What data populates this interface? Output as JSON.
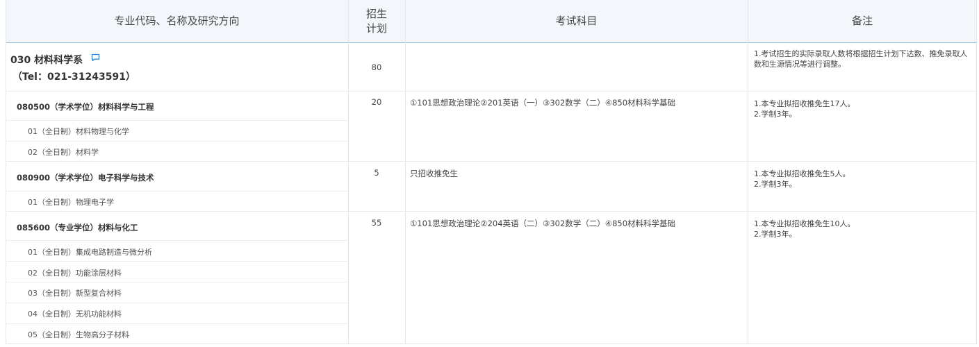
{
  "headers": {
    "major": "专业代码、名称及研究方向",
    "plan_line1": "招生",
    "plan_line2": "计划",
    "subjects": "考试科目",
    "notes": "备注"
  },
  "department": {
    "name": "030 材料科学系",
    "tel": "（Tel：021-31243591）",
    "plan": "80",
    "note": "1.考试招生的实际录取人数将根据招生计划下达数、推免录取人数和生源情况等进行调整。"
  },
  "majors": [
    {
      "title": "080500（学术学位）材料科学与工程",
      "plan": "20",
      "subjects": "①101思想政治理论②201英语（一）③302数学（二）④850材料科学基础",
      "note_lines": [
        "1.本专业拟招收推免生17人。",
        "2.学制3年。"
      ],
      "directions": [
        "01（全日制）材料物理与化学",
        "02（全日制）材料学"
      ]
    },
    {
      "title": "080900（学术学位）电子科学与技术",
      "plan": "5",
      "subjects": "只招收推免生",
      "note_lines": [
        "1.本专业拟招收推免生5人。",
        "2.学制3年。"
      ],
      "directions": [
        "01（全日制）物理电子学"
      ]
    },
    {
      "title": "085600（专业学位）材料与化工",
      "plan": "55",
      "subjects": "①101思想政治理论②204英语（二）③302数学（二）④850材料科学基础",
      "note_lines": [
        "1.本专业拟招收推免生10人。",
        "2.学制3年。"
      ],
      "directions": [
        "01（全日制）集成电路制造与微分析",
        "02（全日制）功能涂层材料",
        "03（全日制）新型复合材料",
        "04（全日制）无机功能材料",
        "05（全日制）生物高分子材料"
      ]
    }
  ],
  "colors": {
    "header_bg": "#f3f6fa",
    "header_border": "#8fbfd8",
    "icon": "#1e88e5"
  },
  "icons": {
    "message": "comment-icon"
  }
}
